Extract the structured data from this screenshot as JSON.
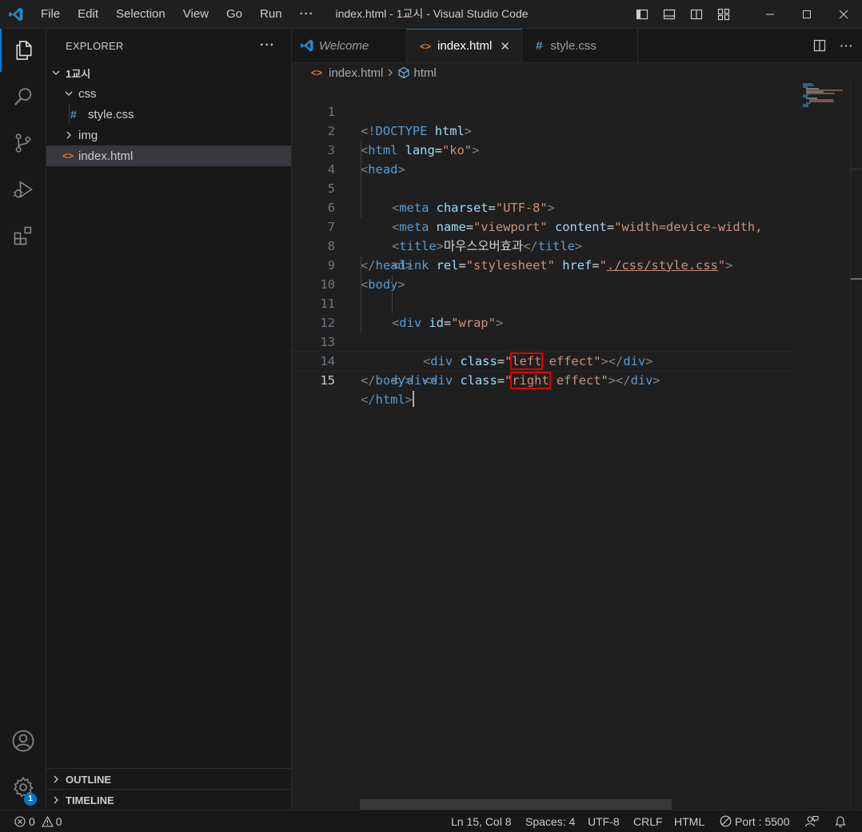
{
  "window": {
    "title": "index.html - 1교시 - Visual Studio Code",
    "menu": [
      "File",
      "Edit",
      "Selection",
      "View",
      "Go",
      "Run",
      "···"
    ]
  },
  "sidebar": {
    "title": "EXPLORER",
    "more": "···",
    "root": "1교시",
    "tree": [
      {
        "label": "css",
        "type": "folder",
        "expanded": true
      },
      {
        "label": "style.css",
        "type": "css-file",
        "icon": "#"
      },
      {
        "label": "img",
        "type": "folder",
        "expanded": false
      },
      {
        "label": "index.html",
        "type": "html-file",
        "icon": "<>",
        "selected": true
      }
    ],
    "sections": [
      "OUTLINE",
      "TIMELINE"
    ]
  },
  "tabs": [
    {
      "label": "Welcome",
      "active": false
    },
    {
      "label": "index.html",
      "active": true,
      "close": "✕"
    },
    {
      "label": "style.css",
      "active": false,
      "icon": "#"
    }
  ],
  "breadcrumb": {
    "file": "index.html",
    "symbol": "html"
  },
  "editor": {
    "line_numbers": [
      "1",
      "2",
      "3",
      "4",
      "5",
      "6",
      "7",
      "8",
      "9",
      "10",
      "11",
      "12",
      "13",
      "14",
      "15"
    ],
    "current_line": "15",
    "lines": {
      "l1": {
        "open": "<!",
        "kw": "DOCTYPE",
        "sp": " ",
        "name": "html",
        "close": ">"
      },
      "l2": {
        "open": "<",
        "tag": "html",
        "sp": " ",
        "attr": "lang",
        "eq": "=",
        "val": "\"ko\"",
        "close": ">"
      },
      "l3": {
        "open": "<",
        "tag": "head",
        "close": ">"
      },
      "l4": {
        "open": "<",
        "tag": "meta",
        "sp": " ",
        "attr": "charset",
        "eq": "=",
        "val": "\"UTF-8\"",
        "close": ">"
      },
      "l5": {
        "open": "<",
        "tag": "meta",
        "sp": " ",
        "attr1": "name",
        "eq1": "=",
        "val1": "\"viewport\"",
        "sp2": " ",
        "attr2": "content",
        "eq2": "=",
        "val2": "\"width=device-width,"
      },
      "l6": {
        "open": "<",
        "tag": "title",
        "close": ">",
        "text": "마우스오버효과",
        "endopen": "</",
        "endtag": "title",
        "endclose": ">"
      },
      "l7": {
        "open": "<",
        "tag": "link",
        "sp": " ",
        "attr1": "rel",
        "eq1": "=",
        "val1": "\"stylesheet\"",
        "sp2": " ",
        "attr2": "href",
        "eq2": "=",
        "q1": "\"",
        "url": "./css/style.css",
        "q2": "\"",
        "close": ">"
      },
      "l8": {
        "open": "</",
        "tag": "head",
        "close": ">"
      },
      "l9": {
        "open": "<",
        "tag": "body",
        "close": ">"
      },
      "l10": {
        "open": "<",
        "tag": "div",
        "sp": " ",
        "attr": "id",
        "eq": "=",
        "val": "\"wrap\"",
        "close": ">"
      },
      "l11": {
        "open": "<",
        "tag": "div",
        "sp": " ",
        "attr": "class",
        "eq": "=",
        "q1": "\"",
        "hl": "left",
        "rest": " effect\"",
        "close": ">",
        "endopen": "</",
        "endtag": "div",
        "endclose": ">"
      },
      "l12": {
        "open": "<",
        "tag": "div",
        "sp": " ",
        "attr": "class",
        "eq": "=",
        "q1": "\"",
        "hl": "right",
        "rest": " effect\"",
        "close": ">",
        "endopen": "</",
        "endtag": "div",
        "endclose": ">"
      },
      "l13": {
        "open": "</",
        "tag": "div",
        "close": ">"
      },
      "l14": {
        "open": "</",
        "tag": "body",
        "close": ">"
      },
      "l15": {
        "open": "</",
        "tag": "html",
        "close": ">"
      }
    }
  },
  "status": {
    "errors": "0",
    "warnings": "0",
    "position": "Ln 15, Col 8",
    "spaces": "Spaces: 4",
    "encoding": "UTF-8",
    "eol": "CRLF",
    "language": "HTML",
    "port": "Port : 5500",
    "settings_badge": "1"
  },
  "colors": {
    "accent": "#0078d4",
    "highlight_box": "#e00000",
    "tag": "#569cd6",
    "attribute": "#9cdcfe",
    "string": "#ce9178"
  }
}
